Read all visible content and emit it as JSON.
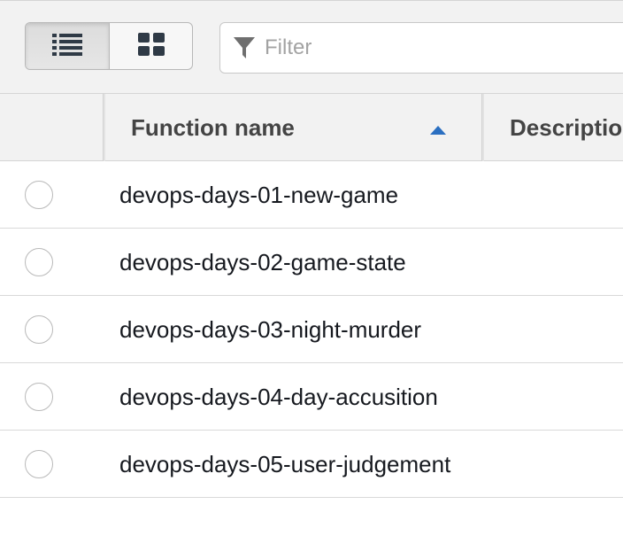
{
  "toolbar": {
    "view_toggle": [
      {
        "icon": "list-view-icon",
        "active": true
      },
      {
        "icon": "grid-view-icon",
        "active": false
      }
    ],
    "filter": {
      "icon": "funnel-icon",
      "placeholder": "Filter",
      "value": ""
    }
  },
  "table": {
    "columns": [
      {
        "label": "Function name",
        "sort": "ascending"
      },
      {
        "label": "Descriptio"
      }
    ],
    "rows": [
      {
        "name": "devops-days-01-new-game"
      },
      {
        "name": "devops-days-02-game-state"
      },
      {
        "name": "devops-days-03-night-murder"
      },
      {
        "name": "devops-days-04-day-accusition"
      },
      {
        "name": "devops-days-05-user-judgement"
      }
    ]
  },
  "colors": {
    "accent": "#2b6fc1",
    "header_bg": "#f2f2f2",
    "border": "#d5d5d5"
  }
}
